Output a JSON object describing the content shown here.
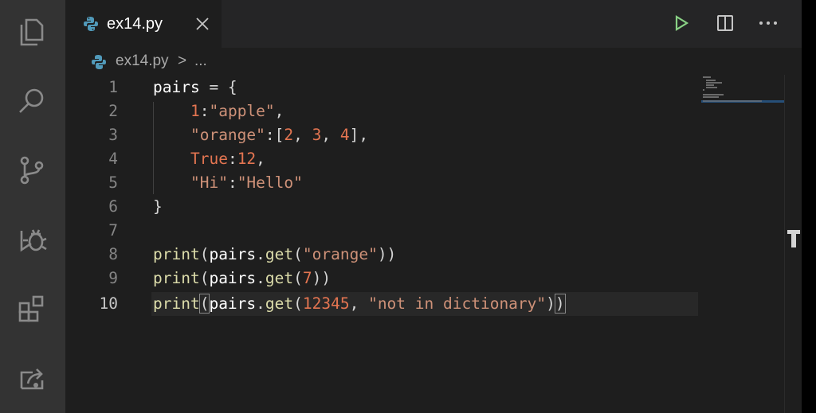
{
  "activity_bar": {
    "icons": [
      "files-icon",
      "search-icon",
      "source-control-icon",
      "debug-icon",
      "extensions-icon",
      "remote-explorer-icon"
    ]
  },
  "tab": {
    "filename": "ex14.py"
  },
  "breadcrumb": {
    "file": "ex14.py",
    "separator": ">",
    "more": "..."
  },
  "editor": {
    "lines": [
      {
        "number": "1",
        "text": "pairs = {"
      },
      {
        "number": "2",
        "text": "    1:\"apple\","
      },
      {
        "number": "3",
        "text": "    \"orange\":[2, 3, 4],"
      },
      {
        "number": "4",
        "text": "    True:12,"
      },
      {
        "number": "5",
        "text": "    \"Hi\":\"Hello\""
      },
      {
        "number": "6",
        "text": "}"
      },
      {
        "number": "7",
        "text": ""
      },
      {
        "number": "8",
        "text": "print(pairs.get(\"orange\"))"
      },
      {
        "number": "9",
        "text": "print(pairs.get(7))"
      },
      {
        "number": "10",
        "text": "print(pairs.get(12345, \"not in dictionary\"))"
      }
    ],
    "current_line": 10
  },
  "colors": {
    "background": "#1e1e1e",
    "activity_bar": "#333333",
    "string": "#ce9178",
    "number": "#e47551",
    "function": "#dcdcaa",
    "run_button": "#89d185"
  }
}
